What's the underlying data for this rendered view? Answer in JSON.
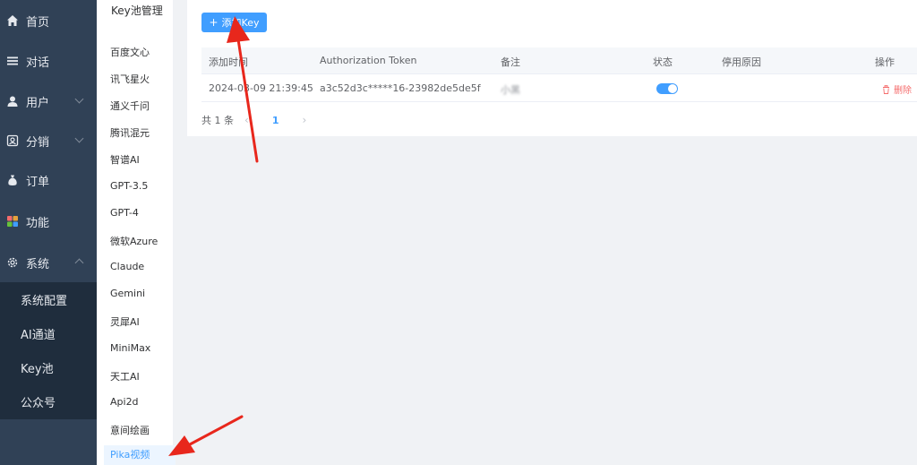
{
  "sidebar": {
    "items": [
      {
        "label": "首页",
        "icon": "home-icon"
      },
      {
        "label": "对话",
        "icon": "menu-lines-icon"
      },
      {
        "label": "用户",
        "icon": "user-icon"
      },
      {
        "label": "分销",
        "icon": "share-icon"
      },
      {
        "label": "订单",
        "icon": "money-bag-icon"
      },
      {
        "label": "功能",
        "icon": "grid-icon"
      },
      {
        "label": "系统",
        "icon": "gear-icon"
      }
    ],
    "submenu": [
      "系统配置",
      "AI通道",
      "Key池",
      "公众号"
    ]
  },
  "keypool": {
    "title": "Key池管理",
    "items": [
      "百度文心",
      "讯飞星火",
      "通义千问",
      "腾讯混元",
      "智谱AI",
      "GPT-3.5",
      "GPT-4",
      "微软Azure",
      "Claude",
      "Gemini",
      "灵犀AI",
      "MiniMax",
      "天工AI",
      "Api2d",
      "意间绘画",
      "Pika视频"
    ],
    "active": "Pika视频"
  },
  "toolbar": {
    "add_label": "添加Key",
    "plus": "+"
  },
  "table": {
    "headers": [
      "添加时间",
      "Authorization Token",
      "备注",
      "状态",
      "停用原因",
      "操作"
    ],
    "rows": [
      {
        "time": "2024-03-09 21:39:45",
        "token": "a3c52d3c*****16-23982de5de5f",
        "note": "小黑",
        "status": true,
        "reason": "",
        "action": "删除"
      }
    ]
  },
  "pagination": {
    "total": "共 1 条",
    "prev": "‹",
    "current": "1",
    "next": "›"
  },
  "colors": {
    "sidebar": "#304156",
    "submenu": "#1f2d3d",
    "accent": "#409eff",
    "danger": "#f56c6c",
    "annotation": "#e8271c"
  }
}
